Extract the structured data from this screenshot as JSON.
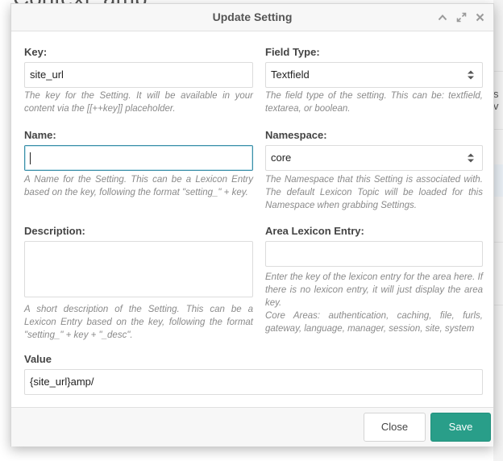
{
  "background": {
    "page_title": "Context: amp",
    "side_snippet": "s v"
  },
  "modal": {
    "title": "Update Setting",
    "tools": [
      "collapse-icon",
      "expand-icon",
      "close-icon"
    ]
  },
  "fields": {
    "key": {
      "label": "Key:",
      "value": "site_url",
      "hint": "The key for the Setting. It will be available in your content via the [[++key]] placeholder."
    },
    "field_type": {
      "label": "Field Type:",
      "value": "Textfield",
      "hint": "The field type of the setting. This can be: textfield, textarea, or boolean."
    },
    "name": {
      "label": "Name:",
      "value": "",
      "hint": "A Name for the Setting. This can be a Lexicon Entry based on the key, following the format \"setting_\" + key."
    },
    "namespace": {
      "label": "Namespace:",
      "value": "core",
      "hint": "The Namespace that this Setting is associated with. The default Lexicon Topic will be loaded for this Namespace when grabbing Settings."
    },
    "description": {
      "label": "Description:",
      "value": "",
      "hint": "A short description of the Setting. This can be a Lexicon Entry based on the key, following the format \"setting_\" + key + \"_desc\"."
    },
    "area": {
      "label": "Area Lexicon Entry:",
      "value": "",
      "hint": "Enter the key of the lexicon entry for the area here. If there is no lexicon entry, it will just display the area key.",
      "hint2": "Core Areas: authentication, caching, file, furls, gateway, language, manager, session, site, system"
    },
    "value": {
      "label": "Value",
      "value": "{site_url}amp/"
    }
  },
  "footer": {
    "close_label": "Close",
    "save_label": "Save"
  },
  "colors": {
    "accent": "#299e89",
    "focus_border": "#3b8fa8"
  }
}
